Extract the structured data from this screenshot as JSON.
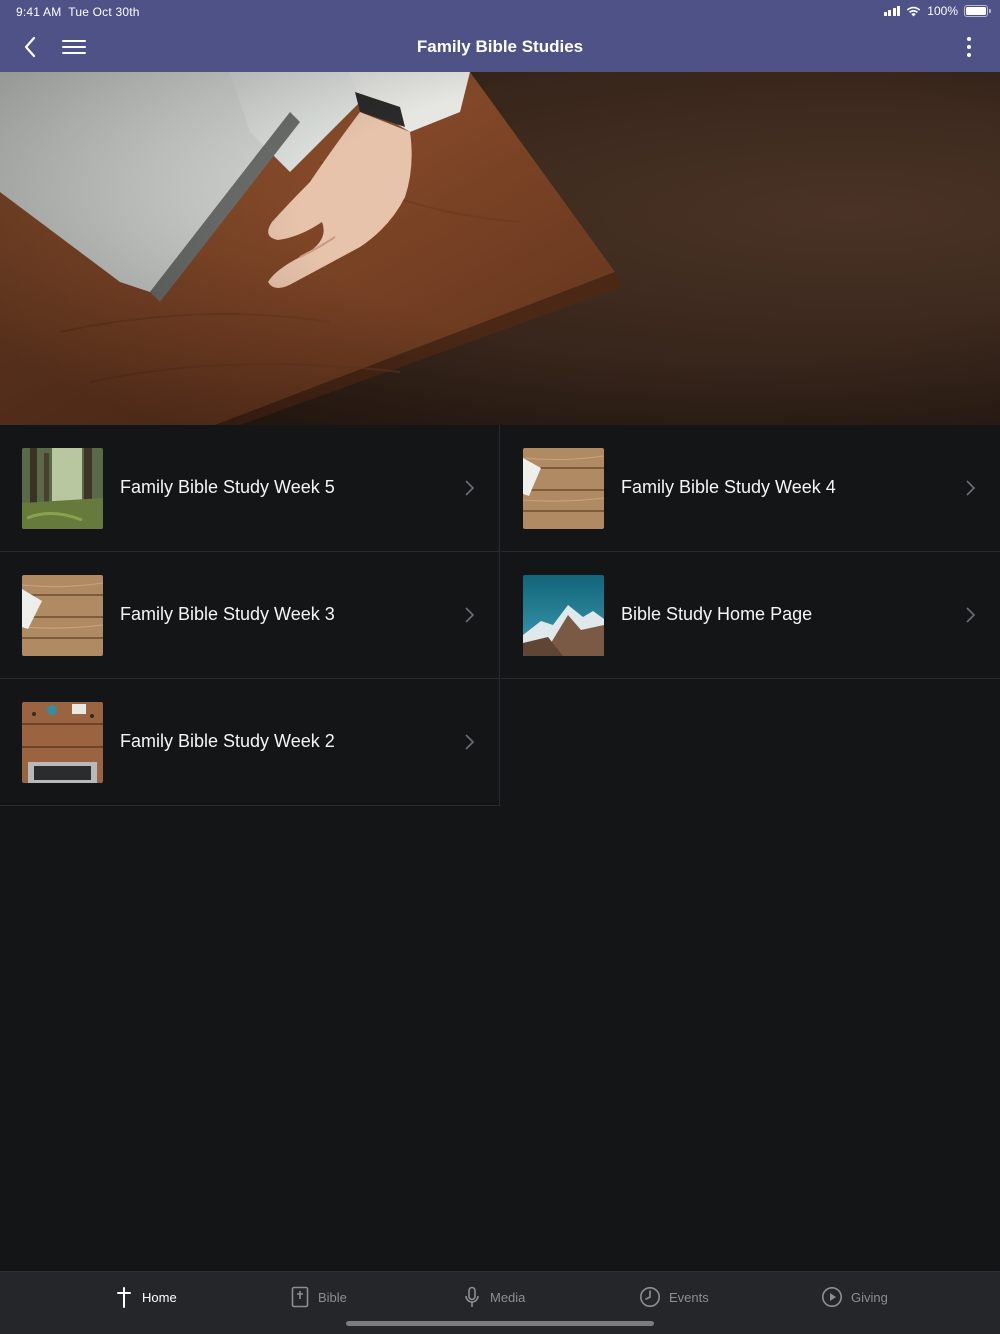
{
  "status_bar": {
    "time": "9:41 AM  Tue Oct 30th",
    "battery": "100%"
  },
  "nav": {
    "title": "Family Bible Studies",
    "back_icon": "chevron-left-icon",
    "menu_icon": "hamburger-icon",
    "more_icon": "more-vertical-icon"
  },
  "hero": {
    "image": "pulpit-open-bible-hand-photo"
  },
  "items": [
    {
      "label": "Family Bible Study Week 5",
      "thumbnail": "forest-photo"
    },
    {
      "label": "Family Bible Study Week 4",
      "thumbnail": "wooden-table-photo"
    },
    {
      "label": "Family Bible Study Week 3",
      "thumbnail": "wooden-table-photo"
    },
    {
      "label": "Bible Study Home Page",
      "thumbnail": "mountain-sky-photo"
    },
    {
      "label": "Family Bible Study Week 2",
      "thumbnail": "desk-laptop-photo"
    }
  ],
  "tabs": [
    {
      "label": "Home",
      "icon": "cross-icon",
      "active": true
    },
    {
      "label": "Bible",
      "icon": "bible-icon",
      "active": false
    },
    {
      "label": "Media",
      "icon": "microphone-icon",
      "active": false
    },
    {
      "label": "Events",
      "icon": "clock-icon",
      "active": false
    },
    {
      "label": "Giving",
      "icon": "play-circle-icon",
      "active": false
    }
  ],
  "colors": {
    "header": "#4e5287",
    "background": "#141517",
    "tabbar": "#25262a",
    "tab_inactive": "#8d8e92",
    "tab_active": "#ffffff"
  }
}
